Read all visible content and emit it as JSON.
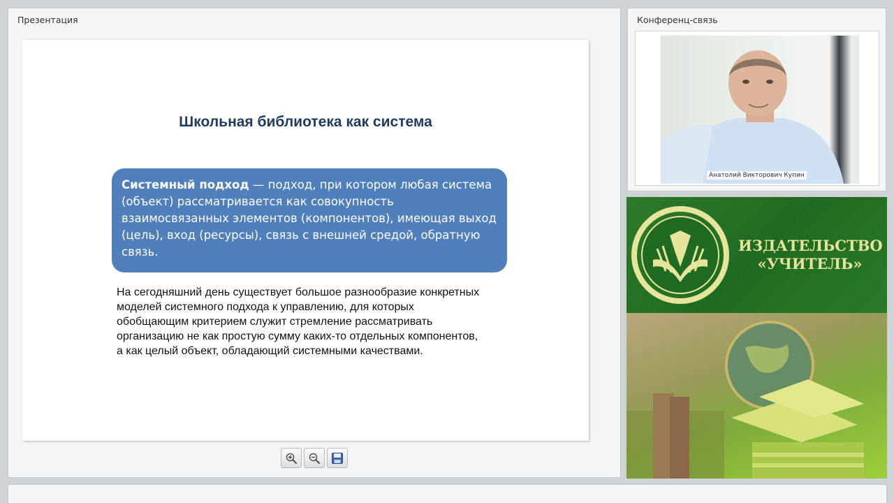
{
  "presentation": {
    "panel_title": "Презентация",
    "slide": {
      "title": "Школьная библиотека как система",
      "definition_term": "Системный подход",
      "definition_text": " — подход, при котором любая система (объект) рассматривается как совокупность взаимосвязанных элементов (компонентов), имеющая выход (цель), вход (ресурсы), связь с внешней средой, обратную связь.",
      "body_text": "На сегодняшний день существует большое разнообразие конкретных моделей системного подхода к управлению, для которых обобщающим критерием служит стремление рассматривать организацию не как простую сумму каких-то отдельных компонентов, а как целый объект, обладающий системными качествами."
    },
    "toolbar": {
      "zoom_in_icon": "zoom-in-icon",
      "zoom_out_icon": "zoom-out-icon",
      "save_icon": "floppy-disk-icon"
    }
  },
  "conference": {
    "panel_title": "Конференц-связь",
    "speaker_name": "Анатолий Викторович Купин"
  },
  "banner": {
    "publisher_name_line1": "ИЗДАТЕЛЬСТВО",
    "publisher_name_line2": "«УЧИТЕЛЬ»"
  },
  "colors": {
    "definition_box": "#4f80bc",
    "slide_title": "#1f3c5f",
    "banner_green": "#1f6b21",
    "banner_text": "#e6e49a"
  }
}
